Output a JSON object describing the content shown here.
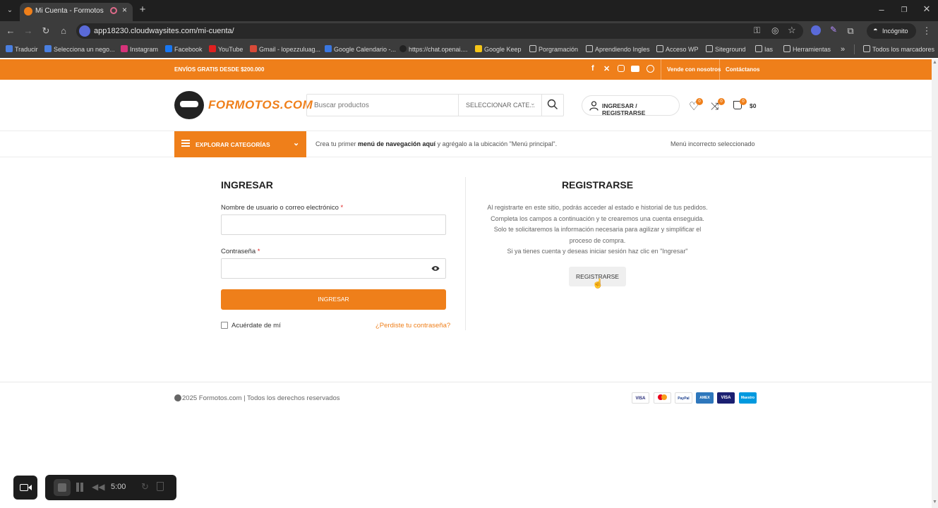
{
  "browser": {
    "tab_title": "Mi Cuenta - Formotos",
    "url": "app18230.cloudwaysites.com/mi-cuenta/",
    "incognito_label": "Incógnito",
    "bookmarks": [
      {
        "label": "Traducir",
        "color": "#4a7fe0"
      },
      {
        "label": "Selecciona un nego...",
        "color": "#4a7fe0"
      },
      {
        "label": "Instagram",
        "color": "#d6337a"
      },
      {
        "label": "Facebook",
        "color": "#1877f2"
      },
      {
        "label": "YouTube",
        "color": "#e02020"
      },
      {
        "label": "Gmail - lopezzuluag...",
        "color": "#d84a38"
      },
      {
        "label": "Google Calendario -...",
        "color": "#3a77e0"
      },
      {
        "label": "https://chat.openai....",
        "color": "#222222"
      },
      {
        "label": "Google Keep",
        "color": "#f5c518"
      },
      {
        "label": "Porgramación",
        "color": "folder"
      },
      {
        "label": "Aprendiendo Ingles",
        "color": "folder"
      },
      {
        "label": "Acceso WP",
        "color": "folder"
      },
      {
        "label": "Siteground",
        "color": "folder"
      },
      {
        "label": "Ias",
        "color": "folder"
      },
      {
        "label": "Herramientas",
        "color": "folder"
      }
    ],
    "more_bookmarks": "»",
    "all_bookmarks": "Todos los marcadores"
  },
  "topbar": {
    "shipping": "ENVÍOS GRATIS DESDE $200.000",
    "link_about": "Vende con nosotros",
    "link_contact": "Contáctanos"
  },
  "header": {
    "logo_text": "FORMOTOS.COM",
    "search_placeholder": "Buscar productos",
    "category_select": "SELECCIONAR CATE...",
    "account_link": "INGRESAR / REGISTRARSE",
    "wishlist_count": "0",
    "compare_count": "0",
    "cart_count": "0",
    "cart_total": "$0"
  },
  "nav": {
    "explore_label": "EXPLORAR CATEGORÍAS",
    "menu_hint_pre": "Crea tu primer",
    "menu_hint_bold": "menú de navegación aquí",
    "menu_hint_post": "y agrégalo a la ubicación \"Menú principal\".",
    "menu_error": "Menú incorrecto seleccionado"
  },
  "login": {
    "title": "INGRESAR",
    "username_label": "Nombre de usuario o correo electrónico",
    "password_label": "Contraseña",
    "required_mark": "*",
    "submit_label": "INGRESAR",
    "remember_label": "Acuérdate de mí",
    "forgot_label": "¿Perdiste tu contraseña?"
  },
  "register": {
    "title": "REGISTRARSE",
    "desc_lines": [
      "Al registrarte en este sitio, podrás acceder al estado e historial de tus pedidos.",
      "Completa los campos a continuación y te crearemos una cuenta enseguida.",
      "Solo te solicitaremos la información necesaria para agilizar y simplificar el",
      "proceso de compra.",
      "Si ya tienes cuenta y deseas iniciar sesión haz clic en \"Ingresar\""
    ],
    "button_label": "REGISTRARSE"
  },
  "footer": {
    "copyright": "2025 Formotos.com | Todos los derechos reservados",
    "payment_methods": [
      {
        "label": "VISA",
        "color": "#1a1f71"
      },
      {
        "label": "MC",
        "color": "#eb001b"
      },
      {
        "label": "PayPal",
        "color": "#ffffff"
      },
      {
        "label": "AMEX",
        "color": "#2e77bc"
      },
      {
        "label": "VISA",
        "color": "#1a1f71"
      },
      {
        "label": "Maestro",
        "color": "#0099df"
      }
    ]
  },
  "recorder": {
    "time": "5:00"
  },
  "colors": {
    "accent": "#ef7f1a",
    "chrome_dark": "#1f1f1f"
  }
}
